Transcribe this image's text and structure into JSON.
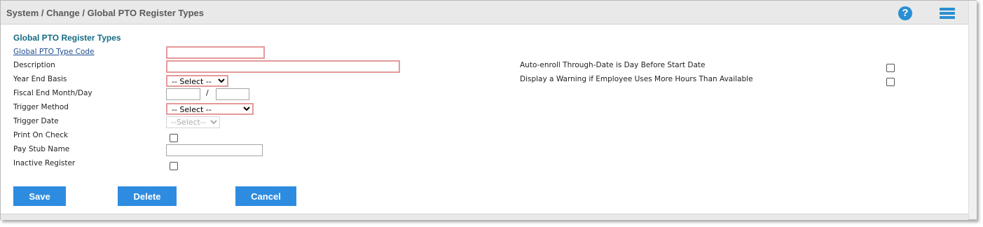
{
  "header": {
    "breadcrumb": "System / Change / Global PTO Register Types",
    "help_icon_glyph": "?",
    "help_icon": "question-circle-icon",
    "menu_icon": "list-menu-icon",
    "accent_color": "#2e8ce0"
  },
  "form": {
    "section_title": "Global PTO Register Types",
    "labels": {
      "type_code": "Global PTO Type Code",
      "description": "Description",
      "year_end_basis": "Year End Basis",
      "fiscal_end": "Fiscal End Month/Day",
      "trigger_method": "Trigger Method",
      "trigger_date": "Trigger Date",
      "print_on_check": "Print On Check",
      "pay_stub_name": "Pay Stub Name",
      "inactive_register": "Inactive Register",
      "auto_enroll": "Auto-enroll Through-Date is Day Before Start Date",
      "display_warning": "Display a Warning if Employee Uses More Hours Than Available"
    },
    "values": {
      "type_code": "",
      "description": "",
      "fiscal_month": "",
      "fiscal_day": "",
      "pay_stub_name": "",
      "year_end_basis": "-- Select --",
      "trigger_method": "-- Select --",
      "trigger_date": "--Select--",
      "fiscal_separator": "/"
    },
    "required_color": "#e49a9a"
  },
  "buttons": {
    "save": "Save",
    "delete": "Delete",
    "cancel": "Cancel"
  }
}
